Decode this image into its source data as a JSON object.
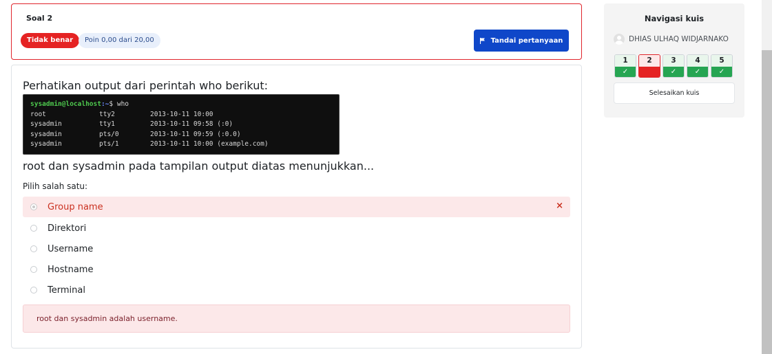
{
  "question": {
    "number_label": "Soal 2",
    "status_badge": "Tidak benar",
    "score_badge": "Poin 0,00 dari 20,00",
    "flag_button": "Tandai pertanyaan",
    "text_before": "Perhatikan output dari perintah who berikut:",
    "terminal": {
      "prompt_user": "sysadmin@localhost",
      "prompt_path": ":~",
      "prompt_symbol": "$ who",
      "rows": [
        [
          "root",
          "tty2",
          "2013-10-11 10:00"
        ],
        [
          "sysadmin",
          "tty1",
          "2013-10-11 09:58 (:0)"
        ],
        [
          "sysadmin",
          "pts/0",
          "2013-10-11 09:59 (:0.0)"
        ],
        [
          "sysadmin",
          "pts/1",
          "2013-10-11 10:00 (example.com)"
        ]
      ]
    },
    "text_after": "root dan sysadmin pada tampilan output diatas menunjukkan...",
    "choose_label": "Pilih salah satu:",
    "answers": [
      {
        "label": "Group name",
        "selected": true,
        "state": "incorrect"
      },
      {
        "label": "Direktori"
      },
      {
        "label": "Username"
      },
      {
        "label": "Hostname"
      },
      {
        "label": "Terminal"
      }
    ],
    "incorrect_mark": "×",
    "feedback": "root dan sysadmin adalah username."
  },
  "nav": {
    "title": "Navigasi kuis",
    "user_name": "DHIAS ULHAQ WIDJARNAKO",
    "questions": [
      {
        "num": "1",
        "state": "correct",
        "mark": "✓"
      },
      {
        "num": "2",
        "state": "wrong",
        "mark": ""
      },
      {
        "num": "3",
        "state": "correct",
        "mark": "✓"
      },
      {
        "num": "4",
        "state": "correct",
        "mark": "✓"
      },
      {
        "num": "5",
        "state": "correct",
        "mark": "✓"
      }
    ],
    "finish_button": "Selesaikan kuis"
  },
  "colors": {
    "danger": "#e52323",
    "primary": "#0f47c9",
    "success": "#26a552"
  }
}
